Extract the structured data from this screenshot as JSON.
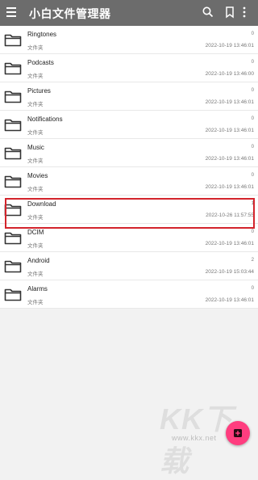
{
  "appbar": {
    "title": "小白文件管理器",
    "icons": [
      "menu-icon",
      "search-icon",
      "bookmark-icon",
      "more-vert-icon"
    ]
  },
  "folders": [
    {
      "name": "Ringtones",
      "type": "文件夹",
      "count": "0",
      "date": "2022-10-19 13:46:01"
    },
    {
      "name": "Podcasts",
      "type": "文件夹",
      "count": "0",
      "date": "2022-10-19 13:46:00"
    },
    {
      "name": "Pictures",
      "type": "文件夹",
      "count": "0",
      "date": "2022-10-19 13:46:01"
    },
    {
      "name": "Notifications",
      "type": "文件夹",
      "count": "0",
      "date": "2022-10-19 13:46:01"
    },
    {
      "name": "Music",
      "type": "文件夹",
      "count": "0",
      "date": "2022-10-19 13:46:01"
    },
    {
      "name": "Movies",
      "type": "文件夹",
      "count": "0",
      "date": "2022-10-19 13:46:01"
    },
    {
      "name": "Download",
      "type": "文件夹",
      "count": "1",
      "date": "2022-10-26 11:57:55"
    },
    {
      "name": "DCIM",
      "type": "文件夹",
      "count": "0",
      "date": "2022-10-19 13:46:01"
    },
    {
      "name": "Android",
      "type": "文件夹",
      "count": "2",
      "date": "2022-10-19 15:03:44"
    },
    {
      "name": "Alarms",
      "type": "文件夹",
      "count": "0",
      "date": "2022-10-19 13:46:01"
    }
  ],
  "highlight_color": "#d3242c",
  "fab_color": "#ff3d7f",
  "watermark": {
    "text": "KK下载",
    "url": "www.kkx.net"
  }
}
